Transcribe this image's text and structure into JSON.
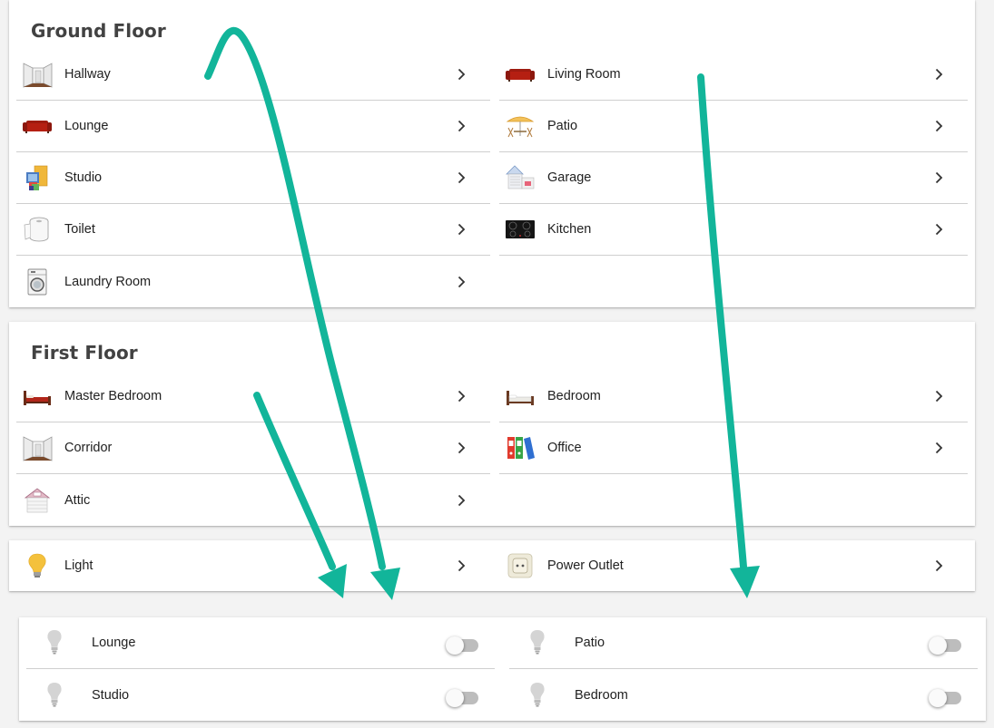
{
  "ground_floor": {
    "title": "Ground Floor",
    "rooms": [
      {
        "label": "Hallway",
        "icon": "hallway-icon"
      },
      {
        "label": "Living Room",
        "icon": "sofa-icon"
      },
      {
        "label": "Lounge",
        "icon": "sofa-icon"
      },
      {
        "label": "Patio",
        "icon": "patio-icon"
      },
      {
        "label": "Studio",
        "icon": "studio-icon"
      },
      {
        "label": "Garage",
        "icon": "garage-icon"
      },
      {
        "label": "Toilet",
        "icon": "toilet-paper-icon"
      },
      {
        "label": "Kitchen",
        "icon": "cooktop-icon"
      },
      {
        "label": "Laundry Room",
        "icon": "washing-machine-icon"
      }
    ]
  },
  "first_floor": {
    "title": "First Floor",
    "rooms": [
      {
        "label": "Master Bedroom",
        "icon": "bed-icon"
      },
      {
        "label": "Bedroom",
        "icon": "bed-icon"
      },
      {
        "label": "Corridor",
        "icon": "hallway-icon"
      },
      {
        "label": "Office",
        "icon": "binders-icon"
      },
      {
        "label": "Attic",
        "icon": "attic-icon"
      }
    ]
  },
  "devices": [
    {
      "label": "Light",
      "icon": "lightbulb-icon"
    },
    {
      "label": "Power Outlet",
      "icon": "power-outlet-icon"
    }
  ],
  "lights": [
    {
      "label": "Lounge",
      "on": false
    },
    {
      "label": "Patio",
      "on": false
    },
    {
      "label": "Studio",
      "on": false
    },
    {
      "label": "Bedroom",
      "on": false
    }
  ],
  "colors": {
    "annotation_arrow": "#12b59a",
    "switch_off": "#bdbdbd",
    "bulb_on": "#f4c13c",
    "bulb_off": "#d0d0d0"
  }
}
